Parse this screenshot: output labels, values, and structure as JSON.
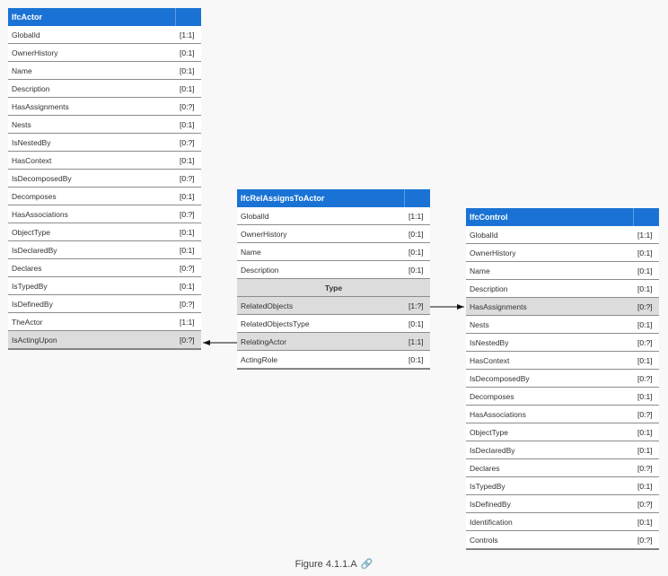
{
  "entities": {
    "actor": {
      "name": "IfcActor",
      "rows": [
        {
          "attr": "GlobalId",
          "card": "[1:1]"
        },
        {
          "attr": "OwnerHistory",
          "card": "[0:1]"
        },
        {
          "attr": "Name",
          "card": "[0:1]"
        },
        {
          "attr": "Description",
          "card": "[0:1]"
        },
        {
          "attr": "HasAssignments",
          "card": "[0:?]"
        },
        {
          "attr": "Nests",
          "card": "[0:1]"
        },
        {
          "attr": "IsNestedBy",
          "card": "[0:?]"
        },
        {
          "attr": "HasContext",
          "card": "[0:1]"
        },
        {
          "attr": "IsDecomposedBy",
          "card": "[0:?]"
        },
        {
          "attr": "Decomposes",
          "card": "[0:1]"
        },
        {
          "attr": "HasAssociations",
          "card": "[0:?]"
        },
        {
          "attr": "ObjectType",
          "card": "[0:1]"
        },
        {
          "attr": "IsDeclaredBy",
          "card": "[0:1]"
        },
        {
          "attr": "Declares",
          "card": "[0:?]"
        },
        {
          "attr": "IsTypedBy",
          "card": "[0:1]"
        },
        {
          "attr": "IsDefinedBy",
          "card": "[0:?]"
        },
        {
          "attr": "TheActor",
          "card": "[1:1]"
        },
        {
          "attr": "IsActingUpon",
          "card": "[0:?]",
          "highlight": true
        }
      ]
    },
    "rel": {
      "name": "IfcRelAssignsToActor",
      "rows": [
        {
          "attr": "GlobalId",
          "card": "[1:1]"
        },
        {
          "attr": "OwnerHistory",
          "card": "[0:1]"
        },
        {
          "attr": "Name",
          "card": "[0:1]"
        },
        {
          "attr": "Description",
          "card": "[0:1]"
        },
        {
          "section": "Type"
        },
        {
          "attr": "RelatedObjects",
          "card": "[1:?]",
          "highlight": true
        },
        {
          "attr": "RelatedObjectsType",
          "card": "[0:1]"
        },
        {
          "attr": "RelatingActor",
          "card": "[1:1]",
          "highlight": true
        },
        {
          "attr": "ActingRole",
          "card": "[0:1]"
        }
      ]
    },
    "control": {
      "name": "IfcControl",
      "rows": [
        {
          "attr": "GlobalId",
          "card": "[1:1]"
        },
        {
          "attr": "OwnerHistory",
          "card": "[0:1]"
        },
        {
          "attr": "Name",
          "card": "[0:1]"
        },
        {
          "attr": "Description",
          "card": "[0:1]"
        },
        {
          "attr": "HasAssignments",
          "card": "[0:?]",
          "highlight": true
        },
        {
          "attr": "Nests",
          "card": "[0:1]"
        },
        {
          "attr": "IsNestedBy",
          "card": "[0:?]"
        },
        {
          "attr": "HasContext",
          "card": "[0:1]"
        },
        {
          "attr": "IsDecomposedBy",
          "card": "[0:?]"
        },
        {
          "attr": "Decomposes",
          "card": "[0:1]"
        },
        {
          "attr": "HasAssociations",
          "card": "[0:?]"
        },
        {
          "attr": "ObjectType",
          "card": "[0:1]"
        },
        {
          "attr": "IsDeclaredBy",
          "card": "[0:1]"
        },
        {
          "attr": "Declares",
          "card": "[0:?]"
        },
        {
          "attr": "IsTypedBy",
          "card": "[0:1]"
        },
        {
          "attr": "IsDefinedBy",
          "card": "[0:?]"
        },
        {
          "attr": "Identification",
          "card": "[0:1]"
        },
        {
          "attr": "Controls",
          "card": "[0:?]"
        }
      ]
    }
  },
  "caption": {
    "text": "Figure 4.1.1.A",
    "icon": "link-icon"
  },
  "colors": {
    "header": "#1a73d4",
    "highlight": "#dcdcdc"
  }
}
